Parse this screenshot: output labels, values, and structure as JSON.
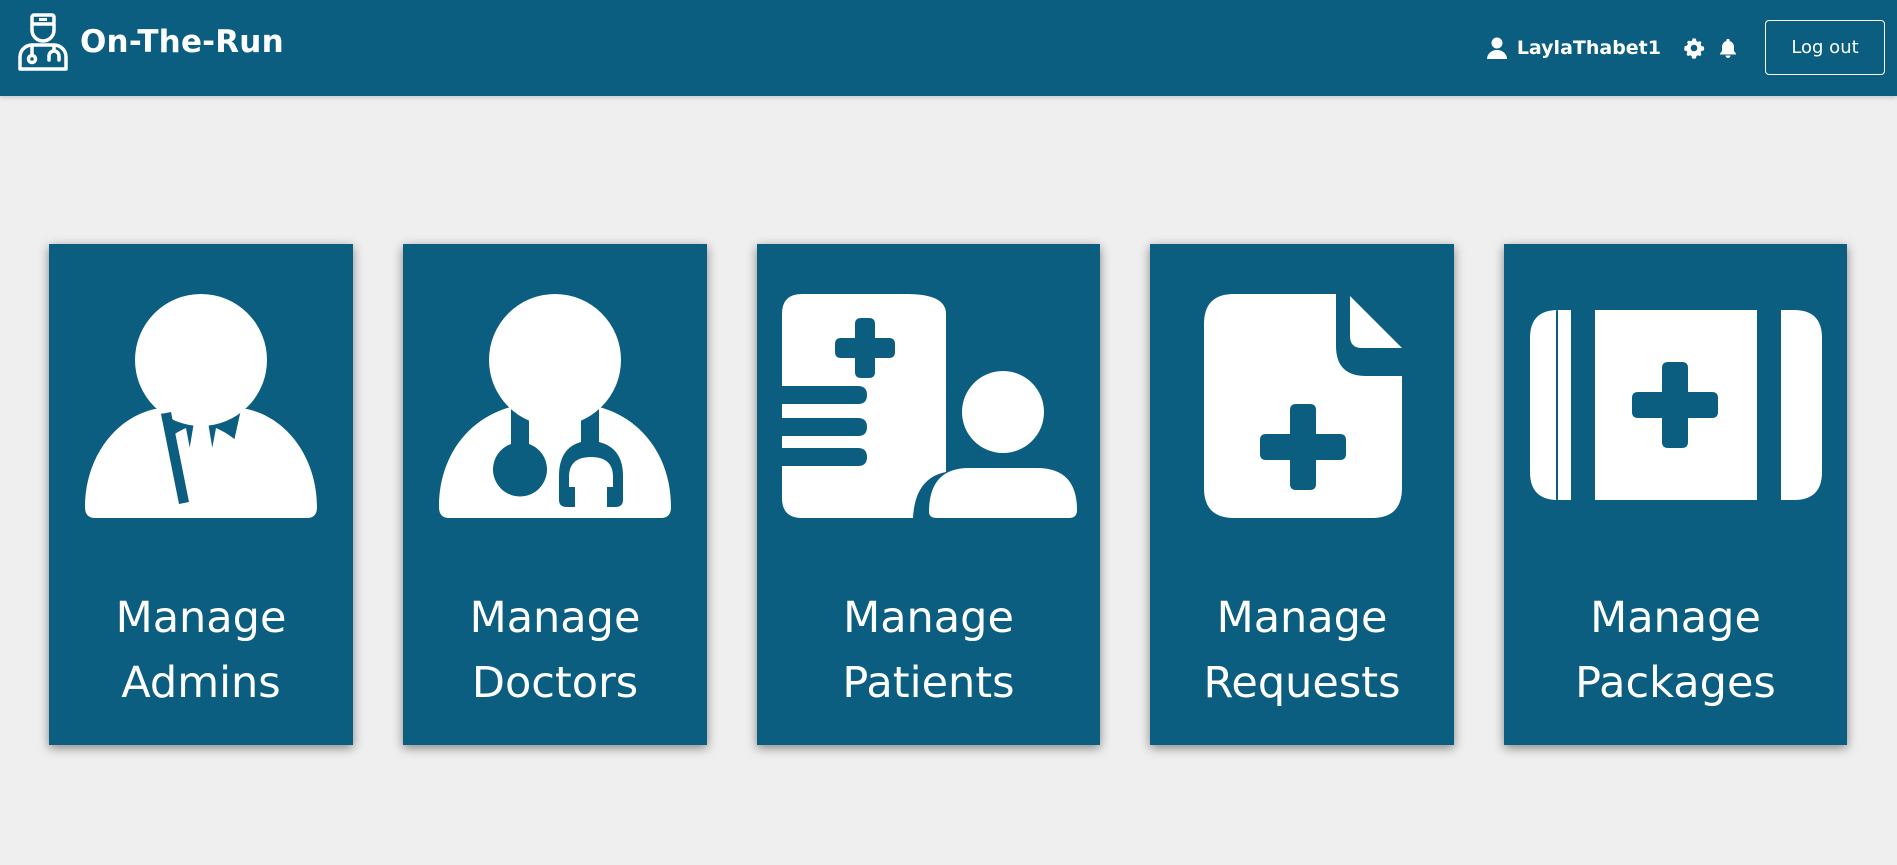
{
  "app": {
    "name": "On-The-Run",
    "brand_color": "#0b5e80",
    "background_color": "#efefef"
  },
  "header": {
    "username": "LaylaThabet1",
    "icons": [
      "user-icon",
      "gear-icon",
      "bell-icon"
    ],
    "logout_label": "Log out"
  },
  "cards": [
    {
      "line1": "Manage",
      "line2": "Admins",
      "icon": "admin-icon"
    },
    {
      "line1": "Manage",
      "line2": "Doctors",
      "icon": "doctor-icon"
    },
    {
      "line1": "Manage",
      "line2": "Patients",
      "icon": "patient-icon"
    },
    {
      "line1": "Manage",
      "line2": "Requests",
      "icon": "medical-file-icon"
    },
    {
      "line1": "Manage",
      "line2": "Packages",
      "icon": "medical-kit-icon"
    }
  ]
}
